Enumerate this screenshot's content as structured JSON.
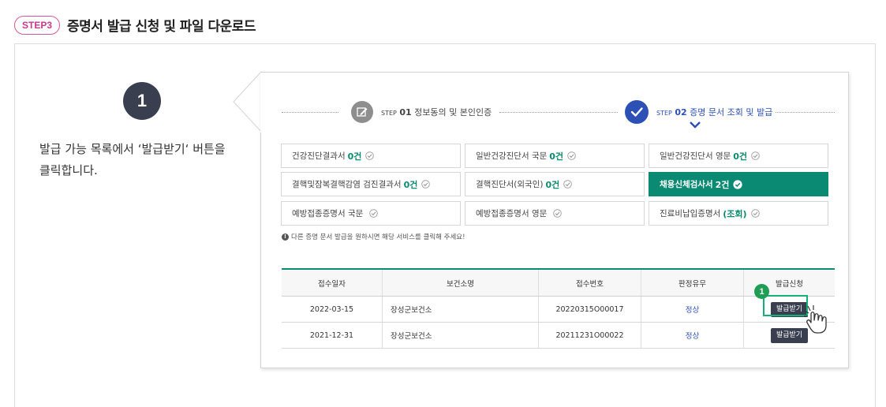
{
  "header": {
    "step_label": "STEP3",
    "title": "증명서 발급 신청 및 파일 다운로드"
  },
  "guide": {
    "number": "1",
    "instruction_line1": "발급 가능 목록에서 ‘발급받기‘ 버튼을",
    "instruction_line2": "클릭합니다."
  },
  "progress": {
    "step1": {
      "prefix": "STEP",
      "no": "01",
      "label": "정보동의 및 본인인증"
    },
    "step2": {
      "prefix": "STEP",
      "no": "02",
      "label": "증명 문서 조회 및 발급"
    }
  },
  "documents": [
    {
      "name": "건강진단결과서",
      "count": "0건"
    },
    {
      "name": "일반건강진단서 국문",
      "count": "0건"
    },
    {
      "name": "일반건강진단서 영문",
      "count": "0건"
    },
    {
      "name": "결핵및잠복결핵감염 검진결과서",
      "count": "0건"
    },
    {
      "name": "결핵진단서(외국인)",
      "count": "0건"
    },
    {
      "name": "채용신체검사서",
      "count": "2건"
    },
    {
      "name": "예방접종증명서 국문",
      "count": ""
    },
    {
      "name": "예방접종증명서 영문",
      "count": ""
    },
    {
      "name": "진료비납입증명서",
      "count": "(조회)"
    }
  ],
  "note": "다른 증명 문서 발급을 원하시면 해당 서비스를 클릭해 주세요!",
  "table": {
    "headers": [
      "접수일자",
      "보건소명",
      "접수번호",
      "판정유무",
      "발급신청"
    ],
    "rows": [
      {
        "date": "2022-03-15",
        "center": "장성군보건소",
        "number": "20220315O00017",
        "status": "정상",
        "action": "발급받기"
      },
      {
        "date": "2021-12-31",
        "center": "장성군보건소",
        "number": "20211231O00022",
        "status": "정상",
        "action": "발급받기"
      }
    ]
  },
  "callout": {
    "badge": "1"
  },
  "colors": {
    "accent_pink": "#c8388e",
    "teal": "#0a8a72",
    "blue": "#2c50b5",
    "dark": "#3a3f4f"
  },
  "icons": [
    "edit-icon",
    "check-circle-icon",
    "chevron-down-icon",
    "check-small-icon",
    "info-icon",
    "hand-pointer-icon"
  ]
}
